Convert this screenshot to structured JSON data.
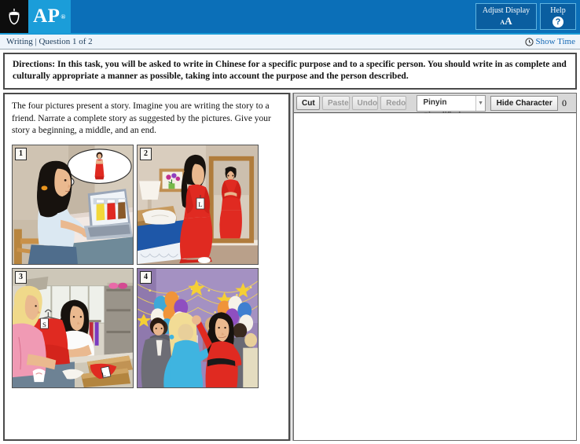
{
  "header": {
    "logo_alt": "College Board acorn",
    "brand": "AP",
    "brand_reg": "®",
    "adjust_display_label": "Adjust Display",
    "adjust_display_glyph_small": "A",
    "adjust_display_glyph_big": "A",
    "help_label": "Help",
    "help_glyph": "?",
    "colors": {
      "header_blue": "#0b6fb8",
      "ap_tile_blue": "#1b9dd9",
      "accent_line": "#1a9ad6",
      "button_blue": "#0a5ea0"
    }
  },
  "statusbar": {
    "section": "Writing | Question 1 of 2",
    "show_time_label": "Show Time",
    "clock_icon": "clock-icon",
    "link_color": "#1669b5"
  },
  "directions": {
    "text": "Directions: In this task, you will be asked to write in Chinese for a specific purpose and to a specific person. You should write in as complete and culturally appropriate a manner as possible, taking into account the purpose and the person described."
  },
  "question": {
    "prompt": "The four pictures present a story.  Imagine you are writing the story to a friend.  Narrate a complete story as suggested by the pictures.  Give your story a beginning, a middle, and an end.",
    "pictures": [
      {
        "number": "1",
        "caption": "Woman at a desk browsing dresses on a laptop, imagining herself in a red gown"
      },
      {
        "number": "2",
        "caption": "Woman in a red dress with size L tag looking at herself in a full-length mirror in a bedroom"
      },
      {
        "number": "3",
        "caption": "Woman returning the red dress at a store counter; a size S dress hangs on a hanger"
      },
      {
        "number": "4",
        "caption": "Woman in the red dress dancing at a party with balloons and string lights"
      }
    ]
  },
  "toolbar": {
    "cut_label": "Cut",
    "paste_label": "Paste",
    "undo_label": "Undo",
    "redo_label": "Redo",
    "input_method_value": "Pinyin Simplified",
    "dropdown_arrow": "▼",
    "hide_character_count_label": "Hide Character Count",
    "character_count": "0",
    "disabled_buttons": [
      "Paste",
      "Undo",
      "Redo"
    ]
  },
  "editor": {
    "value": "",
    "placeholder": ""
  }
}
